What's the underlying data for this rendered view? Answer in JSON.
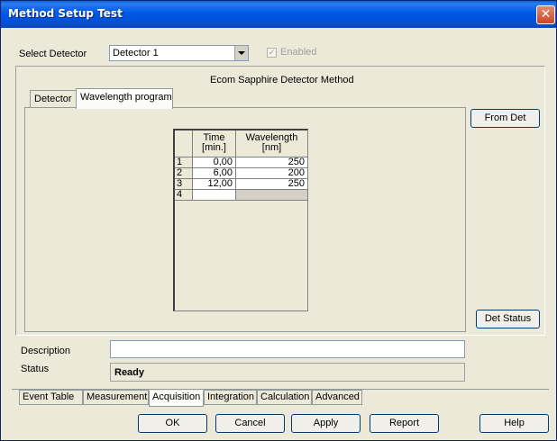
{
  "window": {
    "title": "Method Setup Test",
    "close_glyph": "✕"
  },
  "detector": {
    "label": "Select Detector",
    "selected": "Detector 1",
    "enabled_label": "Enabled",
    "enabled_checked": true
  },
  "method_title": "Ecom Sapphire Detector Method",
  "tabs": [
    {
      "label": "Detector",
      "active": false
    },
    {
      "label": "Wavelength program",
      "active": true
    }
  ],
  "side_buttons": {
    "from_det": "From Det",
    "det_status": "Det Status"
  },
  "table": {
    "col_time_l1": "Time",
    "col_time_l2": "[min.]",
    "col_wl_l1": "Wavelength",
    "col_wl_l2": "[nm]",
    "rows": [
      {
        "num": "1",
        "time": "0,00",
        "wavelength": "250"
      },
      {
        "num": "2",
        "time": "6,00",
        "wavelength": "200"
      },
      {
        "num": "3",
        "time": "12,00",
        "wavelength": "250"
      },
      {
        "num": "4",
        "time": "",
        "wavelength": ""
      }
    ]
  },
  "description": {
    "label": "Description",
    "value": ""
  },
  "status": {
    "label": "Status",
    "value": "Ready"
  },
  "bottom_tabs": [
    {
      "label": "Event Table",
      "active": false
    },
    {
      "label": "Measurement",
      "active": false
    },
    {
      "label": "Acquisition",
      "active": true
    },
    {
      "label": "Integration",
      "active": false
    },
    {
      "label": "Calculation",
      "active": false
    },
    {
      "label": "Advanced",
      "active": false
    }
  ],
  "buttons": {
    "ok": "OK",
    "cancel": "Cancel",
    "apply": "Apply",
    "report": "Report",
    "help": "Help"
  },
  "colors": {
    "titlebar": "#0058e6",
    "dialog_bg": "#ece9d8",
    "close": "#c8452a"
  }
}
